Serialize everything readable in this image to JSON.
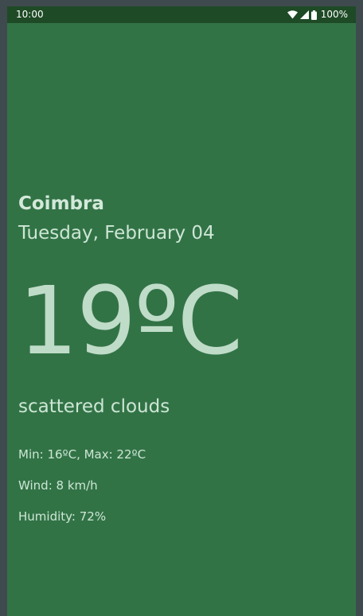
{
  "status_bar": {
    "time": "10:00",
    "battery": "100%",
    "icons": [
      "wifi-icon",
      "signal-icon",
      "battery-icon"
    ]
  },
  "weather": {
    "city": "Coimbra",
    "date": "Tuesday, February 04",
    "temperature": "19ºC",
    "description": "scattered clouds",
    "min_max": "Min: 16ºC, Max: 22ºC",
    "wind": "Wind: 8 km/h",
    "humidity": "Humidity: 72%"
  },
  "colors": {
    "background": "#327346",
    "status_bar": "#1e4a26",
    "text": "#cde6d5"
  }
}
